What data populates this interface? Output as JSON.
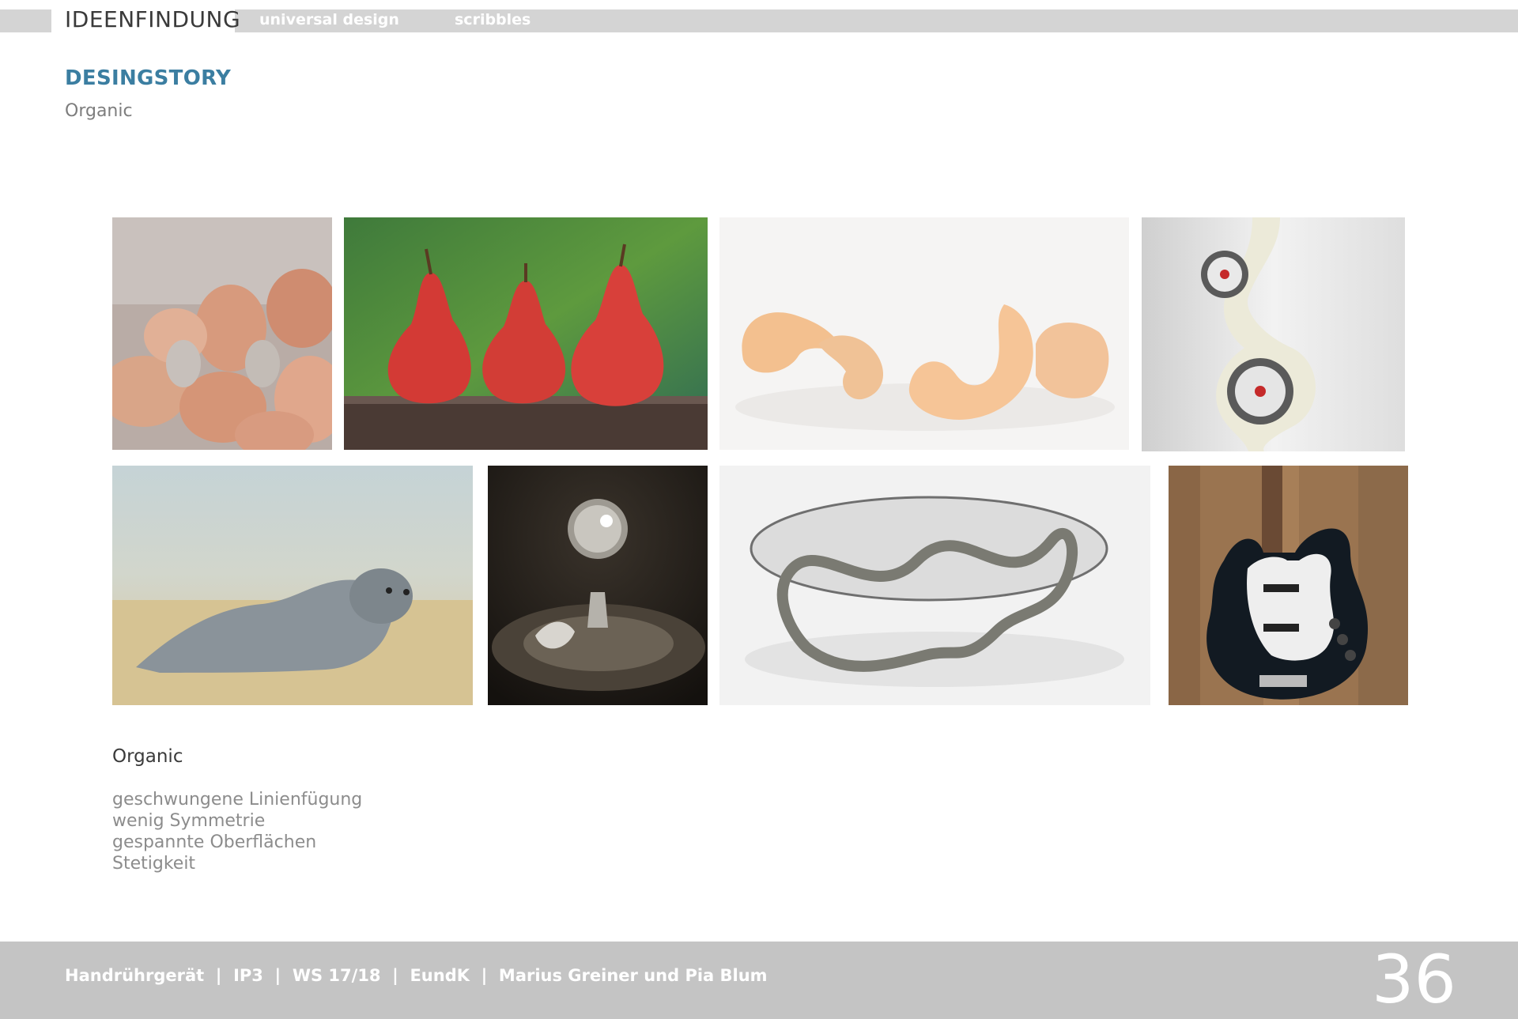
{
  "header": {
    "section": "IDEENFINDUNG",
    "tabs": [
      {
        "label": "universal design"
      },
      {
        "label": "scribbles"
      }
    ]
  },
  "title": "DESINGSTORY",
  "subtitle": "Organic",
  "description": {
    "heading": "Organic",
    "items": [
      "geschwungene Linienfügung",
      "wenig Symmetrie",
      "gespannte Oberflächen",
      "Stetigkeit"
    ]
  },
  "footer": {
    "text": "Handrührgerät  |  IP3  |  WS 17/18  |  EundK  |  Marius Greiner und Pia Blum",
    "page_number": "36"
  }
}
